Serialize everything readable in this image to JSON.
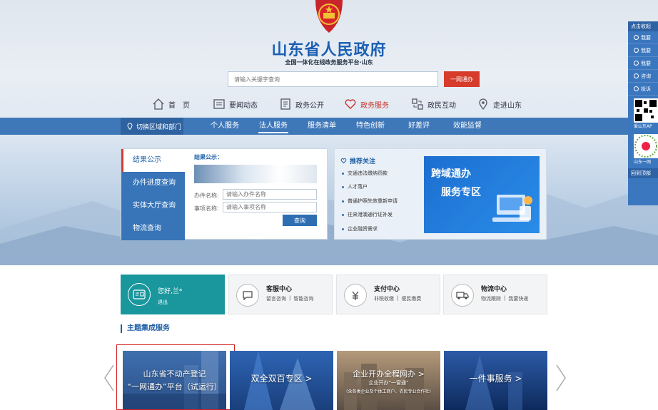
{
  "header": {
    "site_title": "山东省人民政府",
    "site_subtitle": "全国一体化在线政务服务平台·山东",
    "search_placeholder": "请输入关键字查询",
    "search_button": "一网通办"
  },
  "top_nav": [
    {
      "label": "首　页",
      "icon": "home-icon"
    },
    {
      "label": "要闻动态",
      "icon": "news-icon"
    },
    {
      "label": "政务公开",
      "icon": "document-icon"
    },
    {
      "label": "政务服务",
      "icon": "heart-icon",
      "active": true
    },
    {
      "label": "政民互动",
      "icon": "interaction-icon"
    },
    {
      "label": "走进山东",
      "icon": "location-icon"
    }
  ],
  "blue_bar": {
    "region_button": "切换区域和部门",
    "tabs": [
      "个人服务",
      "法人服务",
      "服务清单",
      "特色创新",
      "好差评",
      "效能监督"
    ],
    "active_tab": "法人服务"
  },
  "result_panel": {
    "menu": [
      "结果公示",
      "办件进度查询",
      "实体大厅查询",
      "物流查询"
    ],
    "title": "结果公示：",
    "case_name_label": "办件名称:",
    "case_name_placeholder": "请输入办件名称",
    "item_name_label": "事项名称:",
    "item_name_placeholder": "请输入事项名称",
    "query_button": "查询"
  },
  "recommend": {
    "title": "推荐关注",
    "items": [
      "交通违法缴纳罚款",
      "人才落户",
      "普通护照失效重新申请",
      "往来港澳通行证补发",
      "企业融资需求"
    ],
    "promo_line1": "跨域通办",
    "promo_line2": "服务专区"
  },
  "sidebar": {
    "head": "点击收起",
    "items": [
      "我要",
      "我要",
      "我要",
      "咨询",
      "投诉"
    ],
    "app_label": "爱山东AP",
    "mini_label": "山东一网",
    "back_top": "回到顶部"
  },
  "service_bar": {
    "user": {
      "greeting": "您好,兰*",
      "logout": "退出"
    },
    "cards": [
      {
        "name": "客服中心",
        "subs": [
          "留言咨询",
          "智能咨询"
        ]
      },
      {
        "name": "支付中心",
        "subs": [
          "非税收缴",
          "便民缴费"
        ]
      },
      {
        "name": "物流中心",
        "subs": [
          "物流跟踪",
          "我要快递"
        ]
      }
    ]
  },
  "theme_section": {
    "title": "主题集成服务",
    "cards": [
      {
        "line1": "山东省不动产登记",
        "line2": "“一网通办”平台（试运行）"
      },
      {
        "line1": "双全双百专区 >",
        "line2": ""
      },
      {
        "line1": "企业开办全程网办 >",
        "line2": "企业开办“一窗通”",
        "line3": "（含各类企业及个体工商户、农民专业合作社）"
      },
      {
        "line1": "一件事服务 >",
        "line2": ""
      }
    ]
  },
  "colors": {
    "primary_blue": "#3f78b9",
    "title_blue": "#1b5fb3",
    "accent_red": "#d63b2b",
    "teal": "#19979d"
  }
}
